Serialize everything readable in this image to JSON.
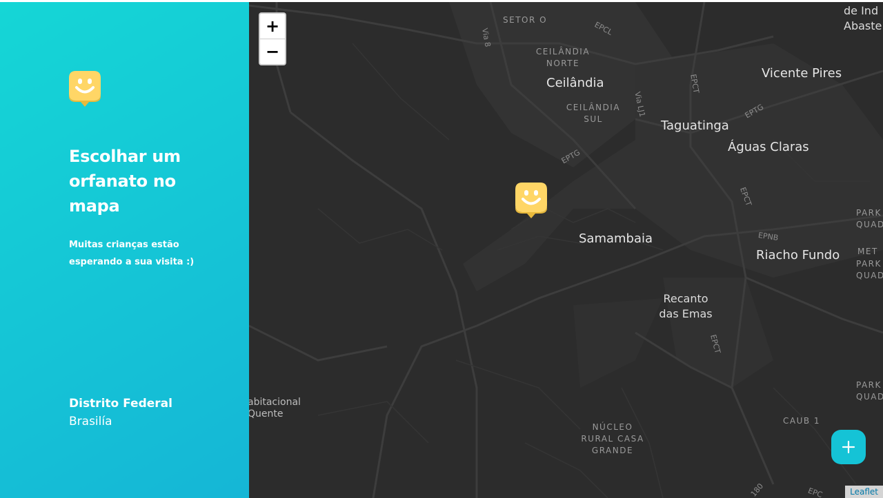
{
  "sidebar": {
    "title": "Escolhar um orfanato no mapa",
    "subtitle": "Muitas crianças estão esperando a sua visita :)",
    "location": {
      "state": "Distrito Federal",
      "city": "Brasilía"
    },
    "logo_icon": "smiley-pin-icon"
  },
  "map": {
    "zoom_in_label": "+",
    "zoom_out_label": "−",
    "attribution": "Leaflet",
    "marker_icon": "smiley-pin-icon",
    "add_button_icon": "plus-icon",
    "labels": {
      "setor_o": "SETOR O",
      "epcl": "EPCL",
      "via8": "Via 8",
      "ceilandia_norte": "CEILÂNDIA NORTE",
      "ceilandia": "Ceilândia",
      "ceilandia_sul": "CEILÂNDIA SUL",
      "via_lj1": "Via LJ1",
      "epct_top": "EPCT",
      "epctg_right": "EPTG",
      "vicente_pires": "Vicente Pires",
      "taguatinga": "Taguatinga",
      "aguas_claras": "Águas Claras",
      "eptg": "EPTG",
      "epct_mid": "EPCT",
      "samambaia": "Samambaia",
      "epnb": "EPNB",
      "riacho_fundo": "Riacho Fundo",
      "recanto": "Recanto das Emas",
      "epct_low": "EPCT",
      "park_quadra_1": "PARK QUADR",
      "park_quadra_2": "PARK QUAD",
      "park_quadra_3": "PARK QUAD",
      "met": "MET",
      "habitacional": "abitacional Quente",
      "nucleo": "NÚCLEO RURAL CASA GRANDE",
      "caub": "CAUB 1",
      "de_ind": "de Ind Abaste",
      "road_180": "180",
      "road_epc": "EPC"
    }
  },
  "colors": {
    "sidebar_start": "#15d6d6",
    "sidebar_end": "#15b6d6",
    "marker_yellow": "#ffd666",
    "fab": "#15c3d6",
    "map_bg": "#2c2c2c"
  }
}
